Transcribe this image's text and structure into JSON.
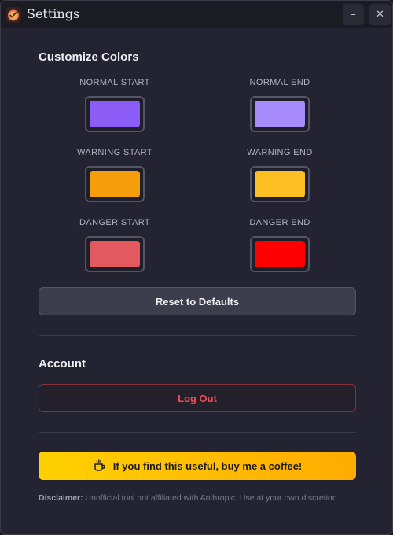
{
  "window": {
    "title": "Settings",
    "minimize_symbol": "–",
    "close_symbol": "✕",
    "app_icon": "timer-app-icon"
  },
  "colors_section": {
    "title": "Customize Colors",
    "swatches": [
      {
        "label": "NORMAL START",
        "color": "#8b5cf6"
      },
      {
        "label": "NORMAL END",
        "color": "#a78bfa"
      },
      {
        "label": "WARNING START",
        "color": "#f59e0b"
      },
      {
        "label": "WARNING END",
        "color": "#fbbf24"
      },
      {
        "label": "DANGER START",
        "color": "#e25a5f"
      },
      {
        "label": "DANGER END",
        "color": "#ff0000"
      }
    ],
    "reset_label": "Reset to Defaults"
  },
  "account_section": {
    "title": "Account",
    "logout_label": "Log Out",
    "logout_color": "#f04b55"
  },
  "support": {
    "coffee_label": "If you find this useful, buy me a coffee!",
    "coffee_icon": "coffee-cup-icon",
    "gradient": [
      "#ffd100",
      "#ffab00"
    ]
  },
  "disclaimer": {
    "prefix": "Disclaimer:",
    "text": "Unofficial tool not affiliated with Anthropic. Use at your own discretion."
  }
}
